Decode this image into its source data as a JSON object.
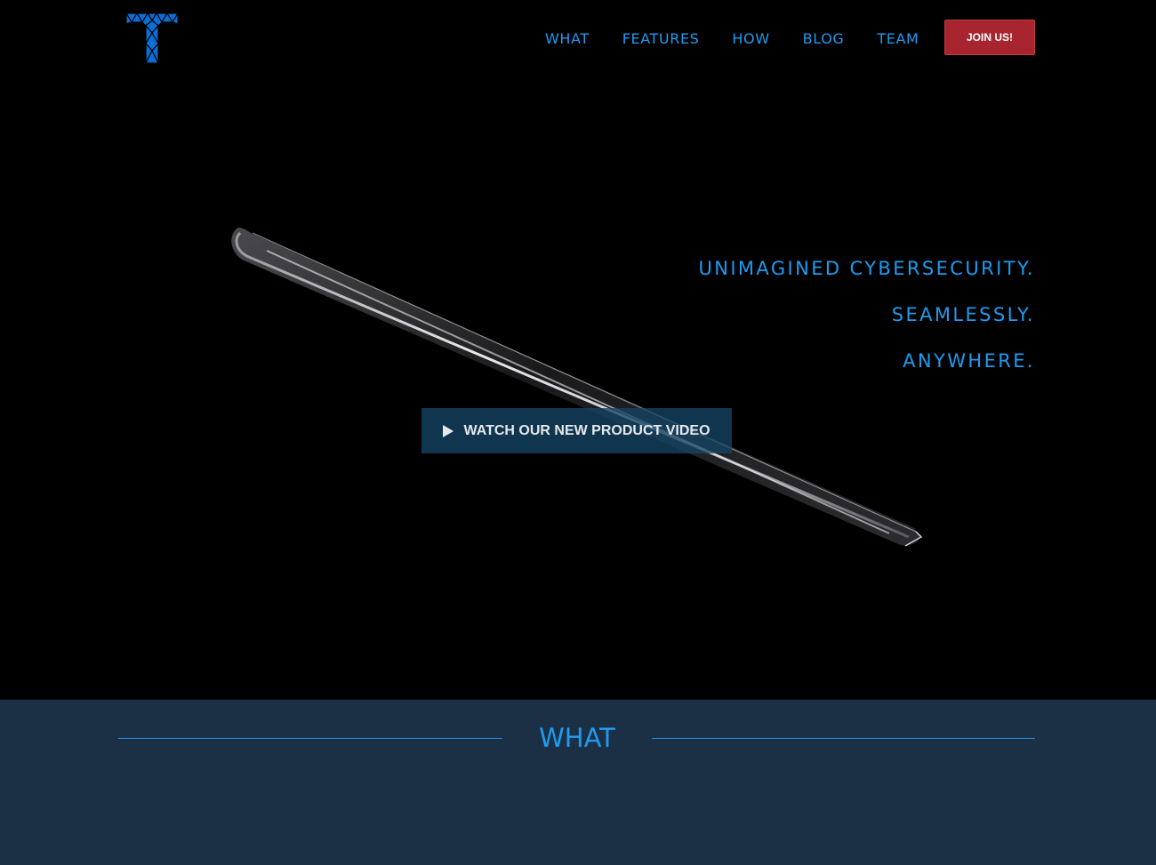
{
  "header": {
    "logo_alt": "T",
    "nav": [
      {
        "label": "WHAT"
      },
      {
        "label": "FEATURES"
      },
      {
        "label": "HOW"
      },
      {
        "label": "BLOG"
      },
      {
        "label": "TEAM"
      }
    ],
    "join_button": "JOIN US!"
  },
  "hero": {
    "tagline": [
      "UNIMAGINED CYBERSECURITY.",
      "SEAMLESSLY.",
      "ANYWHERE."
    ],
    "video_button": "WATCH OUR NEW PRODUCT VIDEO",
    "video_icon": "play-icon"
  },
  "what_section": {
    "title": "WHAT"
  },
  "colors": {
    "accent": "#1e9bf0",
    "join_button_bg": "#a8252f",
    "section_bg": "#1b2f45",
    "hero_bg": "#000000"
  }
}
